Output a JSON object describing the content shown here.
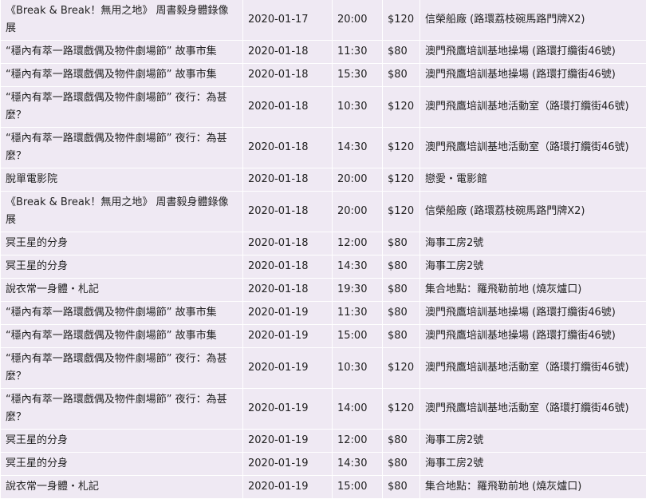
{
  "rows": [
    {
      "name": "《Break & Break！無用之地》 周書毅身體錄像展",
      "date": "2020-01-17",
      "time": "20:00",
      "price": "$120",
      "venue": "信榮船廠 (路環荔枝碗馬路門牌X2)"
    },
    {
      "name": "“穩內有萃一路環戲偶及物件劇場節” 故事市集",
      "date": "2020-01-18",
      "time": "11:30",
      "price": "$80",
      "venue": "澳門飛鷹培訓基地操場 (路環打纜街46號)"
    },
    {
      "name": "“穩內有萃一路環戲偶及物件劇場節” 故事市集",
      "date": "2020-01-18",
      "time": "15:30",
      "price": "$80",
      "venue": "澳門飛鷹培訓基地操場 (路環打纜街46號)"
    },
    {
      "name": "“穩內有萃一路環戲偶及物件劇場節” 夜行：為甚麼？",
      "date": "2020-01-18",
      "time": "10:30",
      "price": "$120",
      "venue": "澳門飛鷹培訓基地活動室（路環打纜街46號)"
    },
    {
      "name": "“穩內有萃一路環戲偶及物件劇場節” 夜行：為甚麼？",
      "date": "2020-01-18",
      "time": "14:30",
      "price": "$120",
      "venue": "澳門飛鷹培訓基地活動室（路環打纜街46號)"
    },
    {
      "name": "脫單電影院",
      "date": "2020-01-18",
      "time": "20:00",
      "price": "$120",
      "venue": "戀愛・電影館"
    },
    {
      "name": "《Break & Break！無用之地》 周書毅身體錄像展",
      "date": "2020-01-18",
      "time": "20:00",
      "price": "$120",
      "venue": "信榮船廠 (路環荔枝碗馬路門牌X2)"
    },
    {
      "name": "冥王星的分身",
      "date": "2020-01-18",
      "time": "12:00",
      "price": "$80",
      "venue": "海事工房2號"
    },
    {
      "name": "冥王星的分身",
      "date": "2020-01-18",
      "time": "14:30",
      "price": "$80",
      "venue": "海事工房2號"
    },
    {
      "name": "說衣常一身體・札記",
      "date": "2020-01-18",
      "time": "19:30",
      "price": "$80",
      "venue": "集合地點：羅飛勒前地 (燒灰爐口)"
    },
    {
      "name": "“穩內有萃一路環戲偶及物件劇場節” 故事市集",
      "date": "2020-01-19",
      "time": "11:30",
      "price": "$80",
      "venue": "澳門飛鷹培訓基地操場 (路環打纜街46號)"
    },
    {
      "name": "“穩內有萃一路環戲偶及物件劇場節” 故事市集",
      "date": "2020-01-19",
      "time": "15:00",
      "price": "$80",
      "venue": "澳門飛鷹培訓基地操場 (路環打纜街46號)"
    },
    {
      "name": "“穩內有萃一路環戲偶及物件劇場節” 夜行：為甚麼？",
      "date": "2020-01-19",
      "time": "10:30",
      "price": "$120",
      "venue": "澳門飛鷹培訓基地活動室（路環打纜街46號)"
    },
    {
      "name": "“穩內有萃一路環戲偶及物件劇場節” 夜行：為甚麼？",
      "date": "2020-01-19",
      "time": "14:00",
      "price": "$120",
      "venue": "澳門飛鷹培訓基地活動室（路環打纜街46號)"
    },
    {
      "name": "冥王星的分身",
      "date": "2020-01-19",
      "time": "12:00",
      "price": "$80",
      "venue": "海事工房2號"
    },
    {
      "name": "冥王星的分身",
      "date": "2020-01-19",
      "time": "14:30",
      "price": "$80",
      "venue": "海事工房2號"
    },
    {
      "name": "說衣常一身體・札記",
      "date": "2020-01-19",
      "time": "15:00",
      "price": "$80",
      "venue": "集合地點：羅飛勒前地 (燒灰爐口)"
    }
  ]
}
